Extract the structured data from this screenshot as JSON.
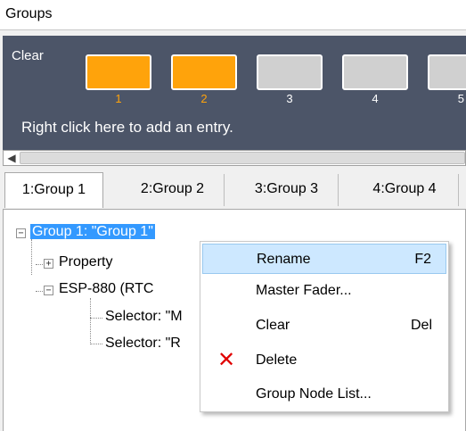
{
  "window": {
    "title": "Groups"
  },
  "group_panel": {
    "clear_label": "Clear",
    "hint": "Right click here to add an entry.",
    "buttons": [
      {
        "number": "1",
        "active": true
      },
      {
        "number": "2",
        "active": true
      },
      {
        "number": "3",
        "active": false
      },
      {
        "number": "4",
        "active": false
      },
      {
        "number": "5",
        "active": false
      }
    ],
    "colors": {
      "active": "#ffa30b",
      "inactive": "#d0d0d0",
      "panel": "#4c5568"
    }
  },
  "tabs": [
    {
      "label": "1:Group 1",
      "active": true
    },
    {
      "label": "2:Group 2",
      "active": false
    },
    {
      "label": "3:Group 3",
      "active": false
    },
    {
      "label": "4:Group 4",
      "active": false
    }
  ],
  "tree": {
    "root": {
      "label": "Group 1: \"Group 1\"",
      "expander": "−"
    },
    "property": {
      "label": "Property",
      "expander": "+"
    },
    "device": {
      "label": "ESP-880 (RTC",
      "expander": "−"
    },
    "selector1": {
      "label": "Selector: \"M"
    },
    "selector2": {
      "label": "Selector: \"R"
    }
  },
  "context_menu": {
    "items": [
      {
        "label": "Rename",
        "shortcut": "F2",
        "icon": ""
      },
      {
        "label": "Master Fader...",
        "shortcut": "",
        "icon": ""
      },
      {
        "label": "Clear",
        "shortcut": "Del",
        "icon": ""
      },
      {
        "label": "Delete",
        "shortcut": "",
        "icon": "delete-x-icon"
      },
      {
        "label": "Group Node List...",
        "shortcut": "",
        "icon": ""
      }
    ]
  }
}
